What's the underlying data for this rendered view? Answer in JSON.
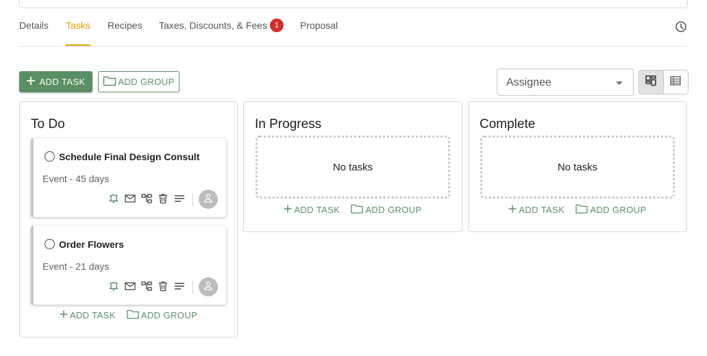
{
  "tabs": [
    {
      "label": "Details"
    },
    {
      "label": "Tasks"
    },
    {
      "label": "Recipes"
    },
    {
      "label": "Taxes, Discounts, & Fees",
      "badge": "1"
    },
    {
      "label": "Proposal"
    }
  ],
  "toolbar": {
    "add_task": "ADD TASK",
    "add_group": "ADD GROUP",
    "assignee_label": "Assignee"
  },
  "columns": [
    {
      "title": "To Do",
      "add_task": "ADD TASK",
      "add_group": "ADD GROUP",
      "tasks": [
        {
          "title": "Schedule Final Design Consult",
          "subtitle": "Event - 45 days"
        },
        {
          "title": "Order Flowers",
          "subtitle": "Event - 21 days"
        }
      ]
    },
    {
      "title": "In Progress",
      "empty_text": "No tasks",
      "add_task": "ADD TASK",
      "add_group": "ADD GROUP"
    },
    {
      "title": "Complete",
      "empty_text": "No tasks",
      "add_task": "ADD TASK",
      "add_group": "ADD GROUP"
    }
  ],
  "colors": {
    "accent_tab": "#e0a100",
    "primary_green": "#5a8f64",
    "badge_red": "#d32f2f"
  },
  "icons": [
    "history-icon",
    "plus-icon",
    "folder-icon",
    "grid-view-icon",
    "list-view-icon",
    "alarm-icon",
    "mail-icon",
    "hierarchy-icon",
    "trash-icon",
    "notes-icon",
    "person-icon"
  ]
}
